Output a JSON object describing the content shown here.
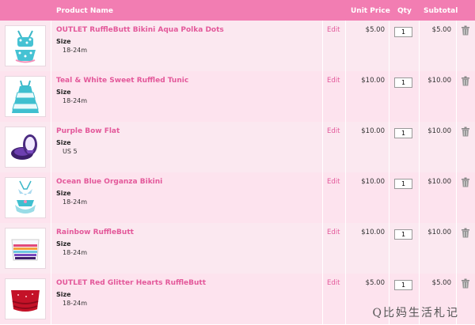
{
  "header": {
    "product_name": "Product Name",
    "unit_price": "Unit Price",
    "qty": "Qty",
    "subtotal": "Subtotal"
  },
  "items": [
    {
      "name": "OUTLET RuffleButt Bikini Aqua Polka Dots",
      "size_label": "Size",
      "size": "18-24m",
      "edit": "Edit",
      "price": "$5.00",
      "qty": "1",
      "subtotal": "$5.00",
      "thumb_icon": "polka-dot-bikini-image"
    },
    {
      "name": "Teal & White Sweet Ruffled Tunic",
      "size_label": "Size",
      "size": "18-24m",
      "edit": "Edit",
      "price": "$10.00",
      "qty": "1",
      "subtotal": "$10.00",
      "thumb_icon": "ruffled-tunic-image"
    },
    {
      "name": "Purple Bow Flat",
      "size_label": "Size",
      "size": "US 5",
      "edit": "Edit",
      "price": "$10.00",
      "qty": "1",
      "subtotal": "$10.00",
      "thumb_icon": "bow-flat-shoes-image"
    },
    {
      "name": "Ocean Blue Organza Bikini",
      "size_label": "Size",
      "size": "18-24m",
      "edit": "Edit",
      "price": "$10.00",
      "qty": "1",
      "subtotal": "$10.00",
      "thumb_icon": "organza-bikini-image"
    },
    {
      "name": "Rainbow RuffleButt",
      "size_label": "Size",
      "size": "18-24m",
      "edit": "Edit",
      "price": "$10.00",
      "qty": "1",
      "subtotal": "$10.00",
      "thumb_icon": "rainbow-rufflebutt-image"
    },
    {
      "name": "OUTLET Red Glitter Hearts RuffleButt",
      "size_label": "Size",
      "size": "18-24m",
      "edit": "Edit",
      "price": "$5.00",
      "qty": "1",
      "subtotal": "$5.00",
      "thumb_icon": "red-rufflebutt-image"
    }
  ],
  "watermark": "Q比妈生活札记",
  "colors": {
    "header": "#f27db2",
    "link": "#e3589a",
    "row_a": "#fbe8f0",
    "row_b": "#fde3ee"
  }
}
